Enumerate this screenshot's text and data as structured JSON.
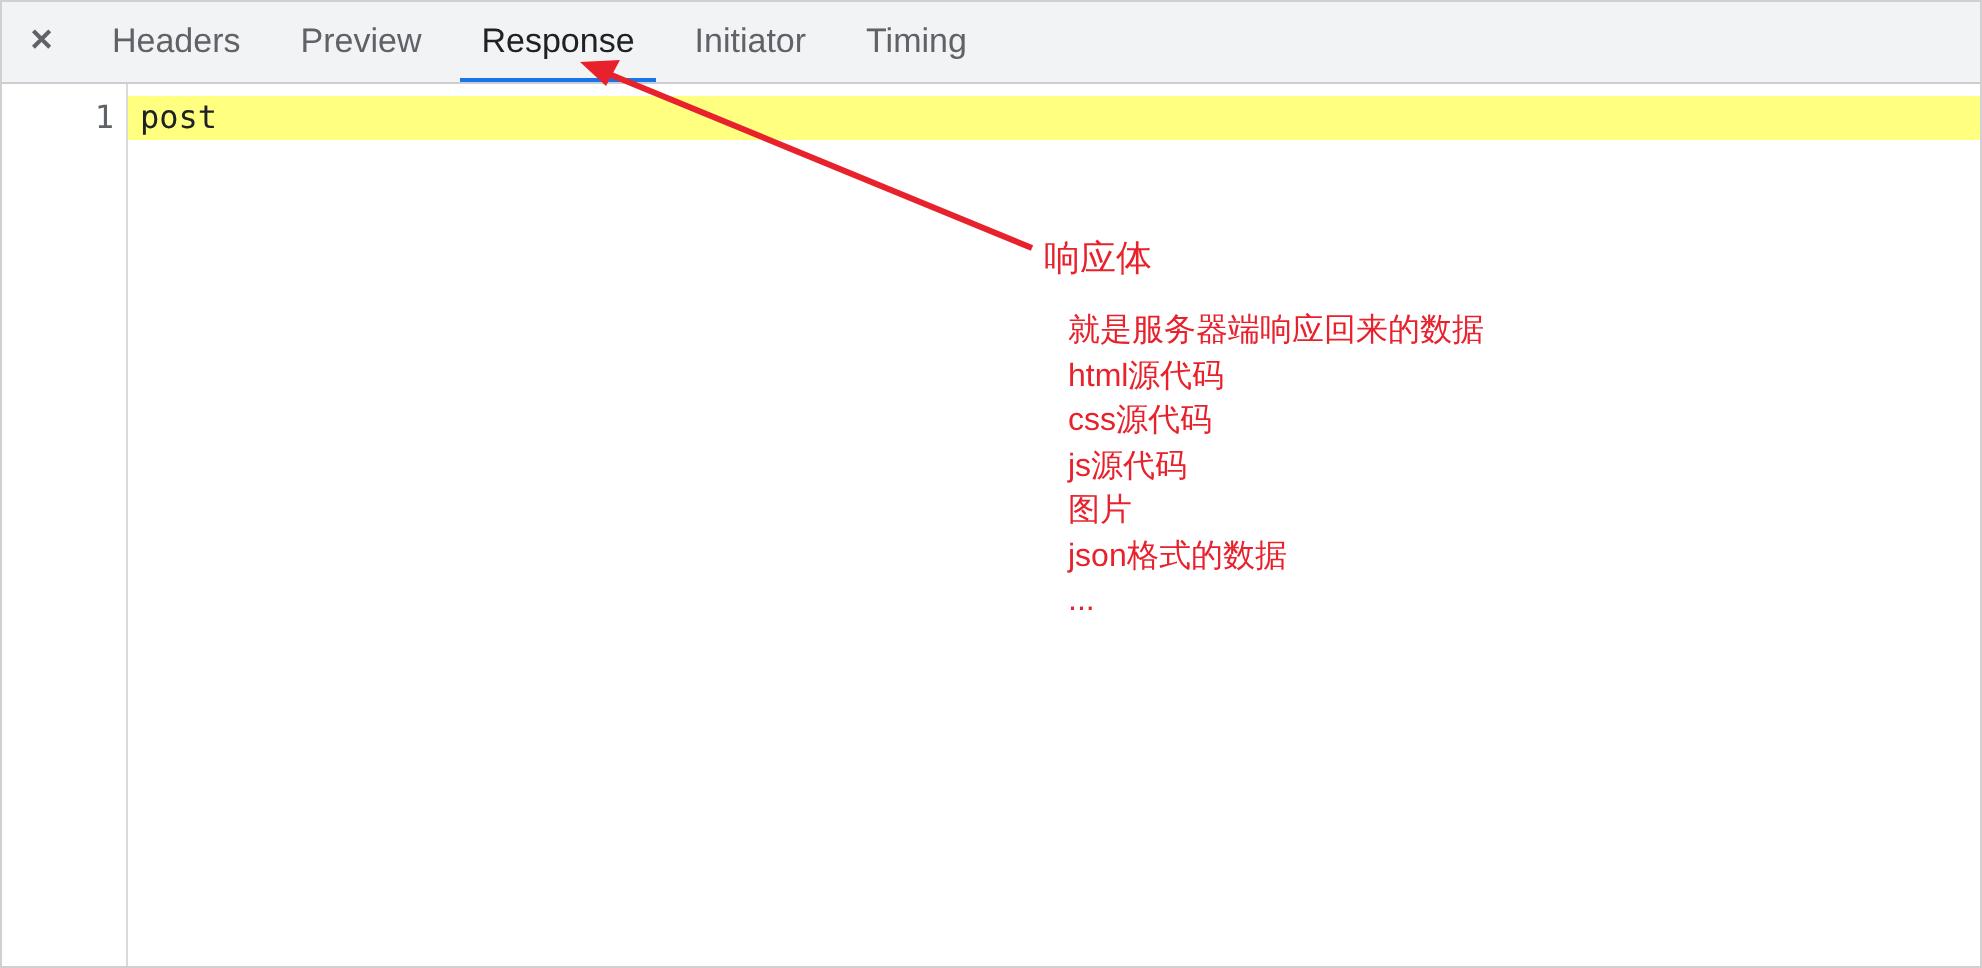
{
  "close_button": "✕",
  "tabs": [
    {
      "label": "Headers",
      "selected": false
    },
    {
      "label": "Preview",
      "selected": false
    },
    {
      "label": "Response",
      "selected": true
    },
    {
      "label": "Initiator",
      "selected": false
    },
    {
      "label": "Timing",
      "selected": false
    }
  ],
  "editor": {
    "lines": [
      {
        "number": "1",
        "text": "post",
        "highlighted": true
      }
    ]
  },
  "annotation": {
    "title": "响应体",
    "notes": [
      "就是服务器端响应回来的数据",
      "html源代码",
      "css源代码",
      "js源代码",
      "图片",
      "json格式的数据",
      "..."
    ]
  }
}
